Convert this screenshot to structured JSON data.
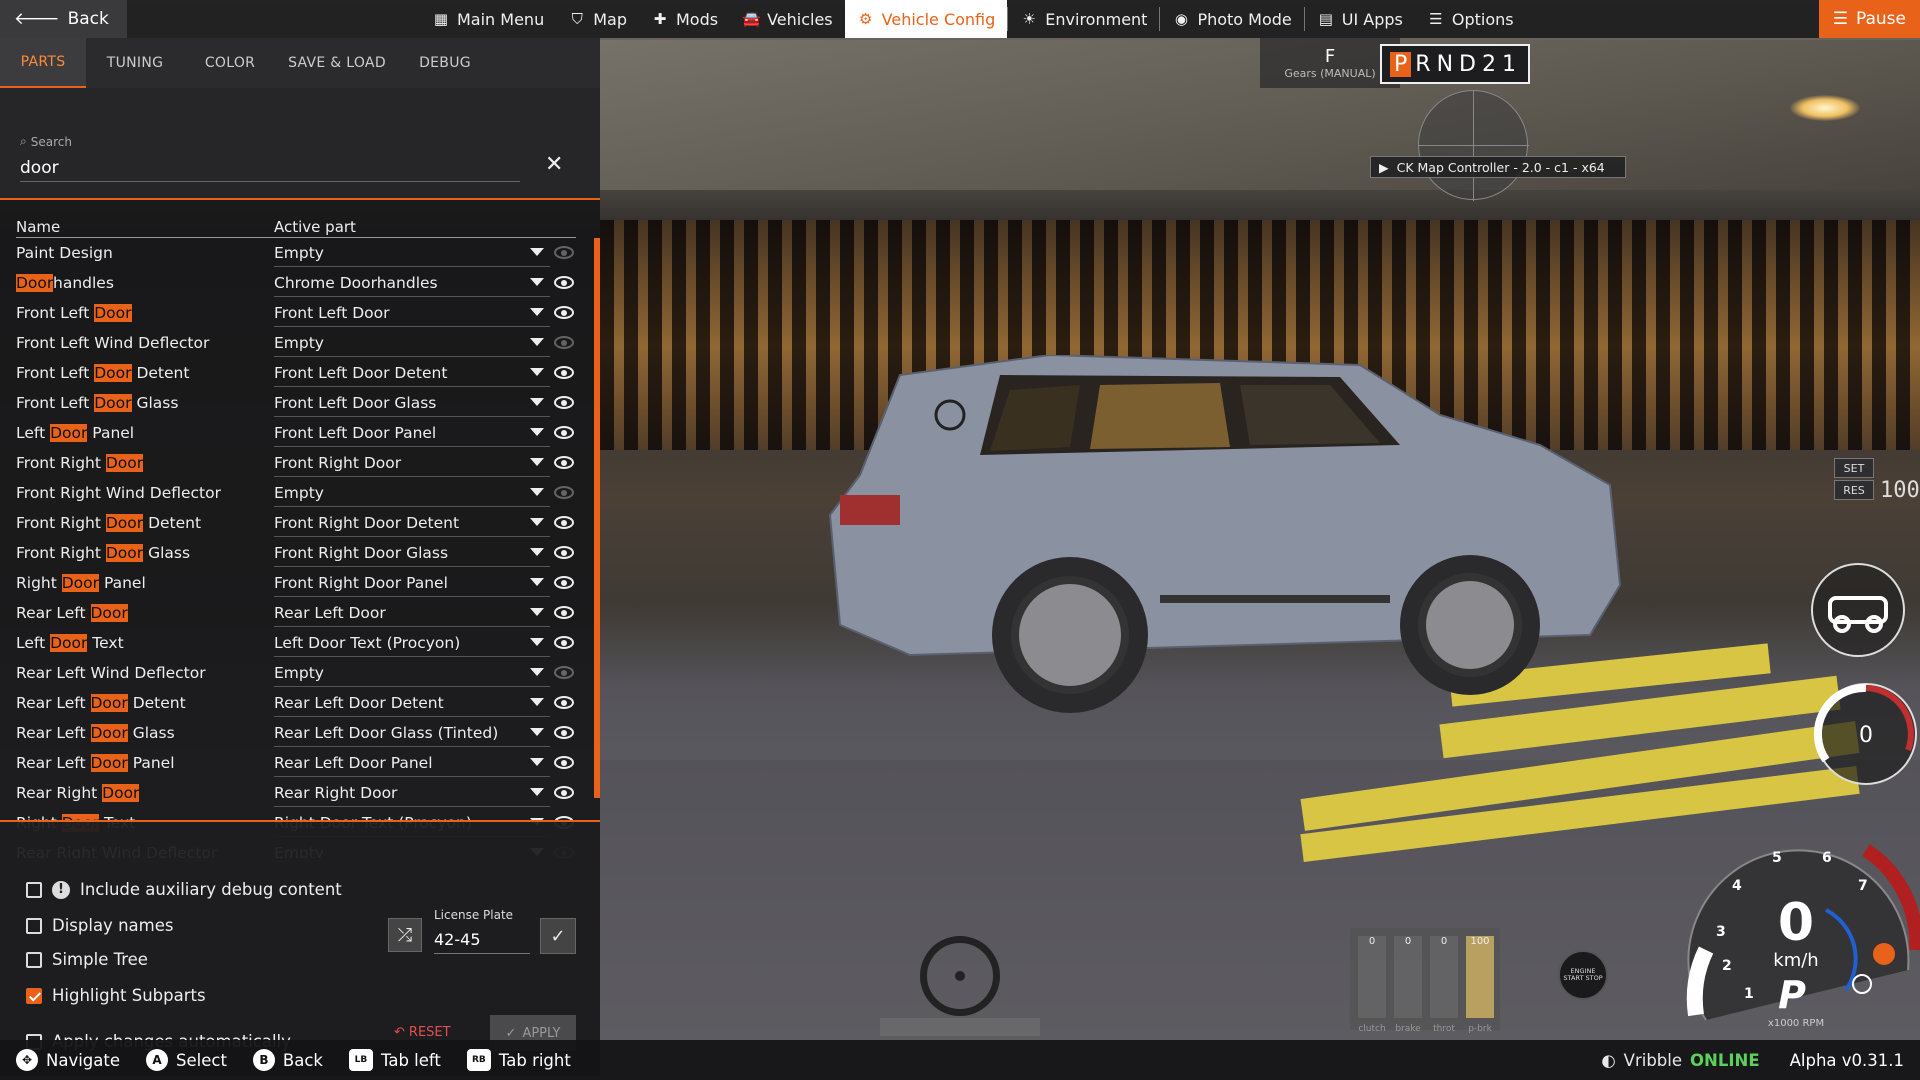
{
  "topbar": {
    "back_label": "Back",
    "nav": [
      {
        "label": "Main Menu",
        "icon": "grid-icon"
      },
      {
        "label": "Map",
        "icon": "map-icon"
      },
      {
        "label": "Mods",
        "icon": "puzzle-icon"
      },
      {
        "label": "Vehicles",
        "icon": "car-icon"
      },
      {
        "label": "Vehicle Config",
        "icon": "engine-icon",
        "active": true
      },
      {
        "label": "Environment",
        "icon": "sun-cloud-icon"
      },
      {
        "label": "Photo Mode",
        "icon": "camera-icon"
      },
      {
        "label": "UI Apps",
        "icon": "apps-icon"
      },
      {
        "label": "Options",
        "icon": "sliders-icon"
      }
    ],
    "pause_label": "Pause"
  },
  "panel": {
    "tabs": [
      "PARTS",
      "TUNING",
      "COLOR",
      "SAVE & LOAD",
      "DEBUG"
    ],
    "active_tab": "PARTS",
    "search": {
      "label": "Search",
      "value": "door"
    },
    "columns": {
      "name": "Name",
      "part": "Active part"
    },
    "rows": [
      {
        "pre": "Paint Design",
        "hl": "",
        "post": "",
        "part": "Empty",
        "visible": false
      },
      {
        "pre": "",
        "hl": "Door",
        "post": "handles",
        "part": "Chrome Doorhandles",
        "visible": true
      },
      {
        "pre": "Front Left ",
        "hl": "Door",
        "post": "",
        "part": "Front Left Door",
        "visible": true
      },
      {
        "pre": "Front Left Wind Deflector",
        "hl": "",
        "post": "",
        "part": "Empty",
        "visible": false
      },
      {
        "pre": "Front Left ",
        "hl": "Door",
        "post": " Detent",
        "part": "Front Left Door Detent",
        "visible": true
      },
      {
        "pre": "Front Left ",
        "hl": "Door",
        "post": " Glass",
        "part": "Front Left Door Glass",
        "visible": true
      },
      {
        "pre": "Left ",
        "hl": "Door",
        "post": " Panel",
        "part": "Front Left Door Panel",
        "visible": true
      },
      {
        "pre": "Front Right ",
        "hl": "Door",
        "post": "",
        "part": "Front Right Door",
        "visible": true
      },
      {
        "pre": "Front Right Wind Deflector",
        "hl": "",
        "post": "",
        "part": "Empty",
        "visible": false
      },
      {
        "pre": "Front Right ",
        "hl": "Door",
        "post": " Detent",
        "part": "Front Right Door Detent",
        "visible": true
      },
      {
        "pre": "Front Right ",
        "hl": "Door",
        "post": " Glass",
        "part": "Front Right Door Glass",
        "visible": true
      },
      {
        "pre": "Right ",
        "hl": "Door",
        "post": " Panel",
        "part": "Front Right Door Panel",
        "visible": true
      },
      {
        "pre": "Rear Left ",
        "hl": "Door",
        "post": "",
        "part": "Rear Left Door",
        "visible": true
      },
      {
        "pre": "Left ",
        "hl": "Door",
        "post": " Text",
        "part": "Left Door Text (Procyon)",
        "visible": true
      },
      {
        "pre": "Rear Left Wind Deflector",
        "hl": "",
        "post": "",
        "part": "Empty",
        "visible": false
      },
      {
        "pre": "Rear Left ",
        "hl": "Door",
        "post": " Detent",
        "part": "Rear Left Door Detent",
        "visible": true
      },
      {
        "pre": "Rear Left ",
        "hl": "Door",
        "post": " Glass",
        "part": "Rear Left Door Glass (Tinted)",
        "visible": true
      },
      {
        "pre": "Rear Left ",
        "hl": "Door",
        "post": " Panel",
        "part": "Rear Left Door Panel",
        "visible": true
      },
      {
        "pre": "Rear Right ",
        "hl": "Door",
        "post": "",
        "part": "Rear Right Door",
        "visible": true
      },
      {
        "pre": "Right ",
        "hl": "Door",
        "post": " Text",
        "part": "Right Door Text (Procyon)",
        "visible": true
      },
      {
        "pre": "Rear Right Wind Deflector",
        "hl": "",
        "post": "",
        "part": "Empty",
        "visible": false
      }
    ],
    "options": [
      {
        "label": "Include auxiliary debug content",
        "checked": false,
        "warn": true
      },
      {
        "label": "Display names",
        "checked": false
      },
      {
        "label": "Simple Tree",
        "checked": false
      },
      {
        "label": "Highlight Subparts",
        "checked": true
      },
      {
        "label": "Apply changes automatically",
        "checked": false
      }
    ],
    "license_plate": {
      "label": "License Plate",
      "value": "42-45"
    },
    "reset_label": "RESET",
    "apply_label": "APPLY"
  },
  "hud": {
    "gear_current": "F",
    "gear_mode": "Gears (MANUAL)",
    "gear_selector": [
      "P",
      "R",
      "N",
      "D",
      "2",
      "1"
    ],
    "map_controller": "CK Map Controller - 2.0 - c1 - x64",
    "cruise_set": "SET",
    "cruise_res": "RES",
    "cruise_value": "100",
    "speed": "0",
    "speed_unit": "km/h",
    "gear_display": "P",
    "rpm_label": "x1000 RPM",
    "rpm_ticks": [
      "1",
      "2",
      "3",
      "4",
      "5",
      "6",
      "7"
    ],
    "boost_value": "0",
    "pedals": [
      {
        "label": "clutch",
        "value": "0"
      },
      {
        "label": "brake",
        "value": "0"
      },
      {
        "label": "throt",
        "value": "0"
      },
      {
        "label": "p-brk",
        "value": "100"
      }
    ],
    "engine_button": "ENGINE START STOP"
  },
  "bottombar": {
    "hints": [
      {
        "key": "✥",
        "label": "Navigate",
        "rect": false
      },
      {
        "key": "A",
        "label": "Select",
        "rect": false
      },
      {
        "key": "B",
        "label": "Back",
        "rect": false
      },
      {
        "key": "LB",
        "label": "Tab left",
        "rect": true
      },
      {
        "key": "RB",
        "label": "Tab right",
        "rect": true
      }
    ],
    "user": "Vribble",
    "status": "ONLINE",
    "version": "Alpha v0.31.1"
  }
}
